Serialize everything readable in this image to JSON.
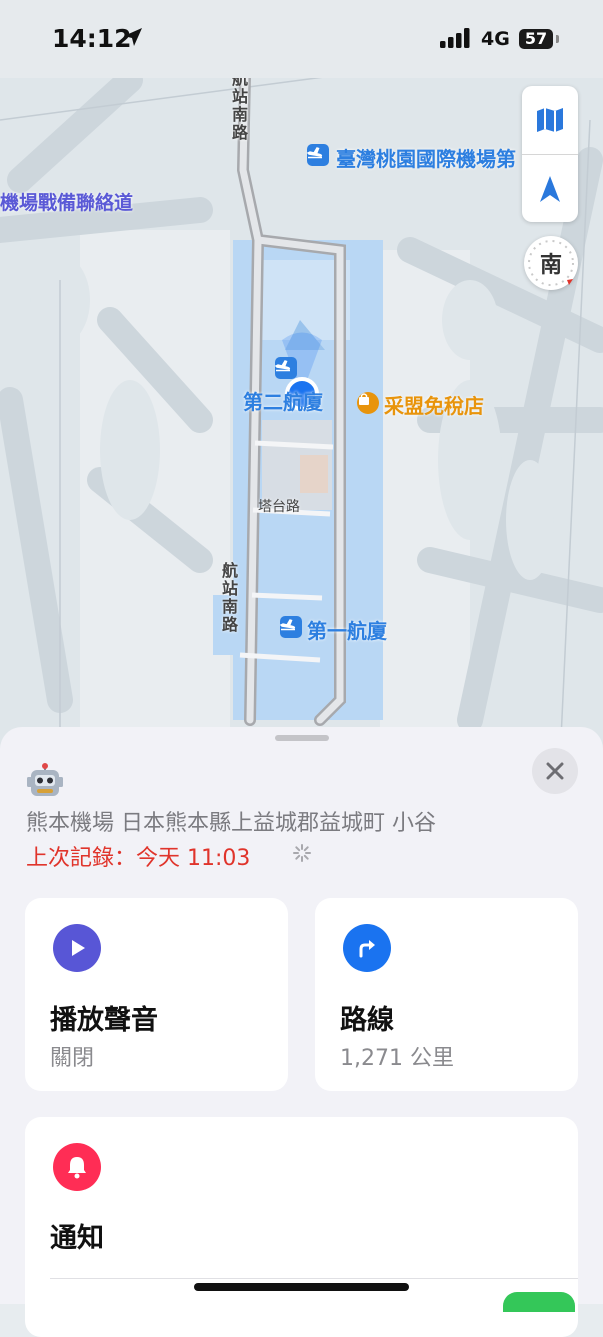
{
  "status_bar": {
    "time": "14:12",
    "network": "4G",
    "battery": "57"
  },
  "map": {
    "road_labels": {
      "road_top": "航站南路",
      "road_bottom": "航站南路",
      "tower_road": "塔台路",
      "liaison_road": "機場戰備聯絡道"
    },
    "poi_labels": {
      "airport": "臺灣桃園國際機場第",
      "terminal_2": "第二航廈",
      "terminal_1": "第一航廈",
      "duty_free": "采盟免稅店"
    },
    "compass_heading": "南",
    "colors": {
      "poi_blue": "#2d7fe0",
      "duty_free_orange": "#e8940c",
      "location_dot": "#1a73f0"
    }
  },
  "detail": {
    "address": "熊本機場 日本熊本縣上益城郡益城町 小谷",
    "last_seen": "上次記錄：今天 11:03",
    "play_sound": {
      "title": "播放聲音",
      "status": "關閉"
    },
    "directions": {
      "title": "路線",
      "distance": "1,271 公里"
    },
    "notifications": {
      "title": "通知"
    }
  },
  "icons": [
    "location-arrow-icon",
    "map-icon",
    "tracking-arrow-icon",
    "compass-icon",
    "airport-icon",
    "shopping-bag-icon",
    "robot-icon",
    "close-icon",
    "play-icon",
    "directions-icon",
    "bell-icon",
    "loading-spinner-icon"
  ]
}
